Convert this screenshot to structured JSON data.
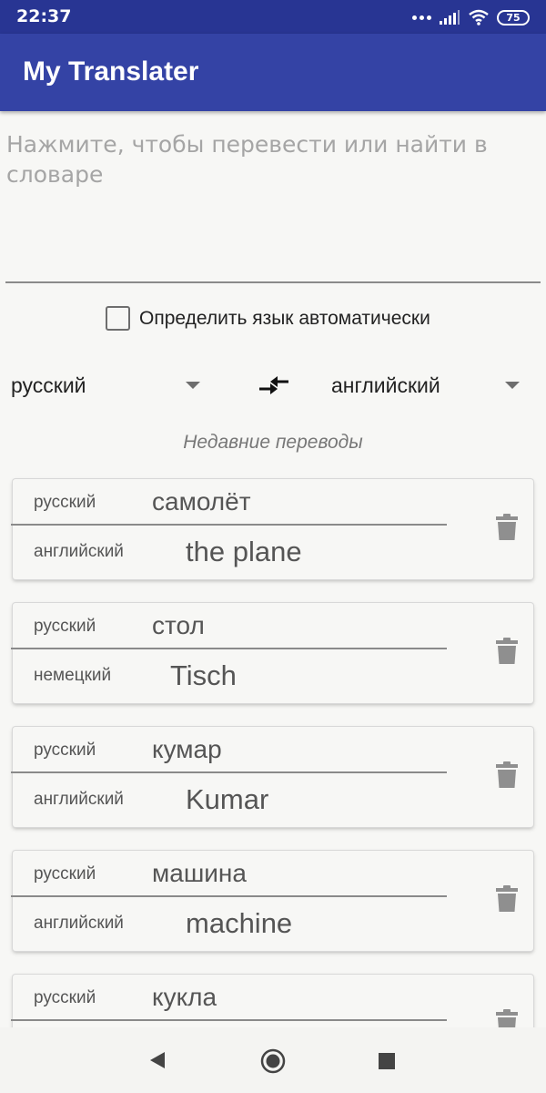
{
  "status_bar": {
    "time": "22:37",
    "battery": "75"
  },
  "app": {
    "title": "My Translater"
  },
  "input": {
    "placeholder": "Нажмите, чтобы перевести или найти в словаре"
  },
  "auto_detect": {
    "label": "Определить язык автоматически",
    "checked": false
  },
  "languages": {
    "source": "русский",
    "target": "английский"
  },
  "recent": {
    "title": "Недавние переводы",
    "items": [
      {
        "source_lang": "русский",
        "source_word": "самолёт",
        "target_lang": "английский",
        "target_word": "the plane"
      },
      {
        "source_lang": "русский",
        "source_word": "стол",
        "target_lang": "немецкий",
        "target_word": "Tisch"
      },
      {
        "source_lang": "русский",
        "source_word": "кумар",
        "target_lang": "английский",
        "target_word": "Kumar"
      },
      {
        "source_lang": "русский",
        "source_word": "машина",
        "target_lang": "английский",
        "target_word": "machine"
      },
      {
        "source_lang": "русский",
        "source_word": "кукла",
        "target_lang": "",
        "target_word": ""
      }
    ]
  },
  "icons": {
    "status": [
      "signal-dots-icon",
      "cell-signal-icon",
      "wifi-icon",
      "battery-icon"
    ],
    "swap": "swap-languages-icon",
    "delete": "trash-icon",
    "nav": [
      "back-icon",
      "home-icon",
      "recents-icon"
    ]
  },
  "colors": {
    "status_bar": "#283593",
    "app_bar": "#3443a5",
    "background": "#f7f7f5",
    "icon_gray": "#8f8f8f"
  }
}
